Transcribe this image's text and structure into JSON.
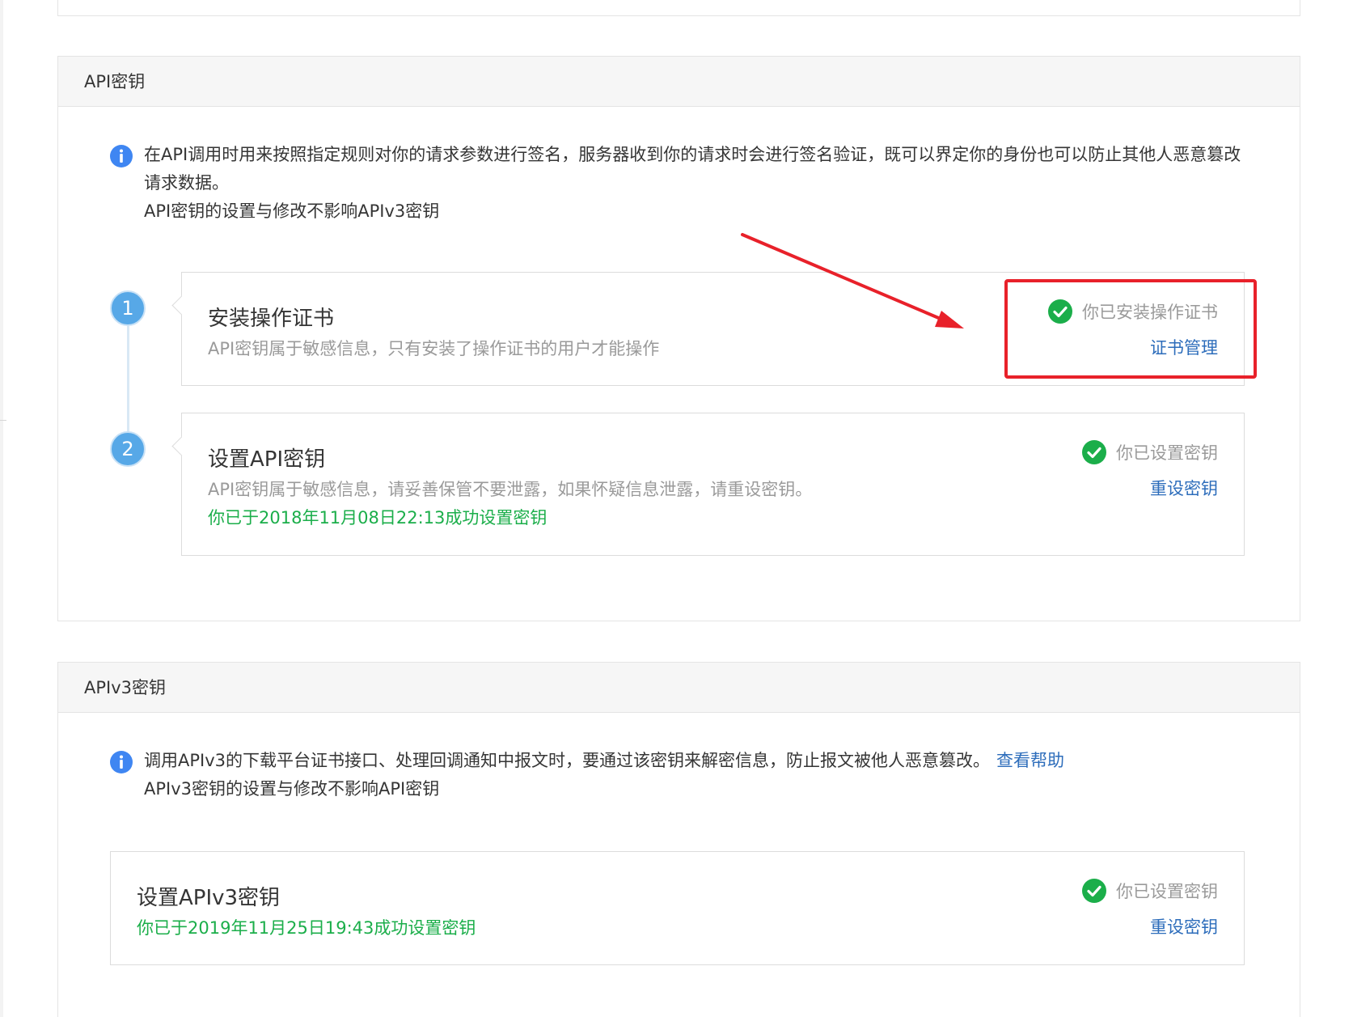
{
  "api_section": {
    "title": "API密钥",
    "info_line1": "在API调用时用来按照指定规则对你的请求参数进行签名，服务器收到你的请求时会进行签名验证，既可以界定你的身份也可以防止其他人恶意篡改请求数据。",
    "info_line2": "API密钥的设置与修改不影响APIv3密钥",
    "steps": [
      {
        "number": "1",
        "title": "安装操作证书",
        "description": "API密钥属于敏感信息，只有安装了操作证书的用户才能操作",
        "status": "你已安装操作证书",
        "action": "证书管理"
      },
      {
        "number": "2",
        "title": "设置API密钥",
        "description": "API密钥属于敏感信息，请妥善保管不要泄露，如果怀疑信息泄露，请重设密钥。",
        "success_message": "你已于2018年11月08日22:13成功设置密钥",
        "status": "你已设置密钥",
        "action": "重设密钥"
      }
    ]
  },
  "apiv3_section": {
    "title": "APIv3密钥",
    "info_line1": "调用APIv3的下载平台证书接口、处理回调通知中报文时，要通过该密钥来解密信息，防止报文被他人恶意篡改。",
    "help_link": "查看帮助",
    "info_line2": "APIv3密钥的设置与修改不影响API密钥",
    "card": {
      "title": "设置APIv3密钥",
      "success_message": "你已于2019年11月25日19:43成功设置密钥",
      "status": "你已设置密钥",
      "action": "重设密钥"
    }
  },
  "colors": {
    "link": "#2d6dbb",
    "success": "#1bae4a",
    "step_circle": "#57a8e7",
    "highlight": "#e8212a",
    "info_icon": "#3f86f2"
  }
}
